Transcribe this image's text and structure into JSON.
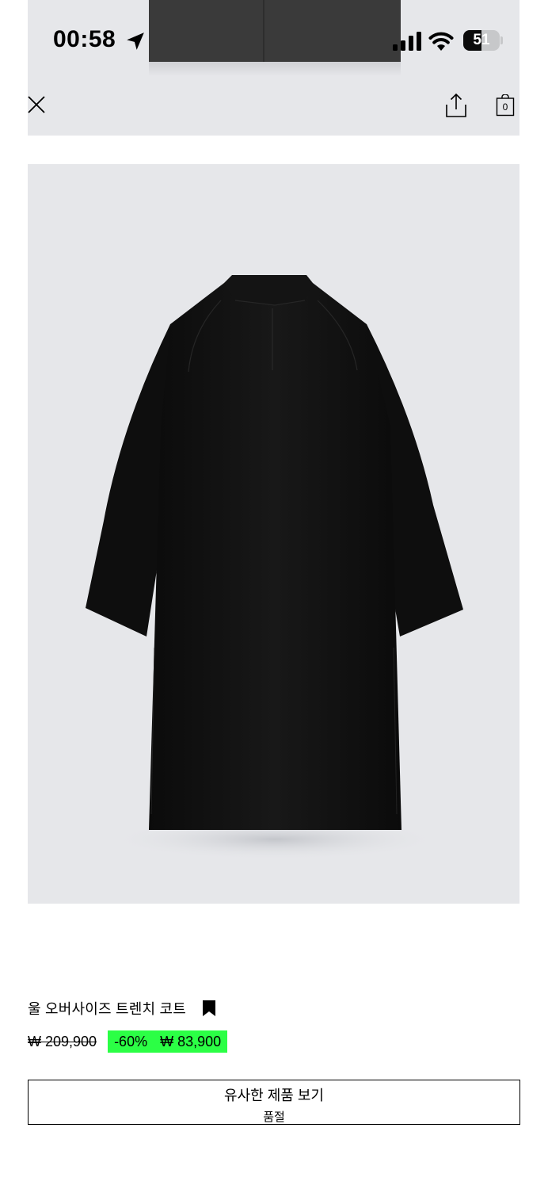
{
  "status_bar": {
    "time": "00:58",
    "battery_level": "51",
    "battery_fraction": 0.51
  },
  "header": {
    "close_icon": "close-icon",
    "share_icon": "share-icon",
    "bag_icon": "shopping-bag-icon",
    "bag_count": "0"
  },
  "product": {
    "name": "울 오버사이즈 트렌치 코트",
    "bookmark_icon": "bookmark-icon",
    "original_price": "₩ 209,900",
    "discount": "-60%",
    "sale_price": "₩ 83,900",
    "sale_highlight_color": "#2bff45"
  },
  "actions": {
    "similar_products_label": "유사한 제품 보기",
    "sold_out_label": "품절"
  },
  "colors": {
    "photo_background": "#e6e7ea",
    "coat": "#111111"
  }
}
